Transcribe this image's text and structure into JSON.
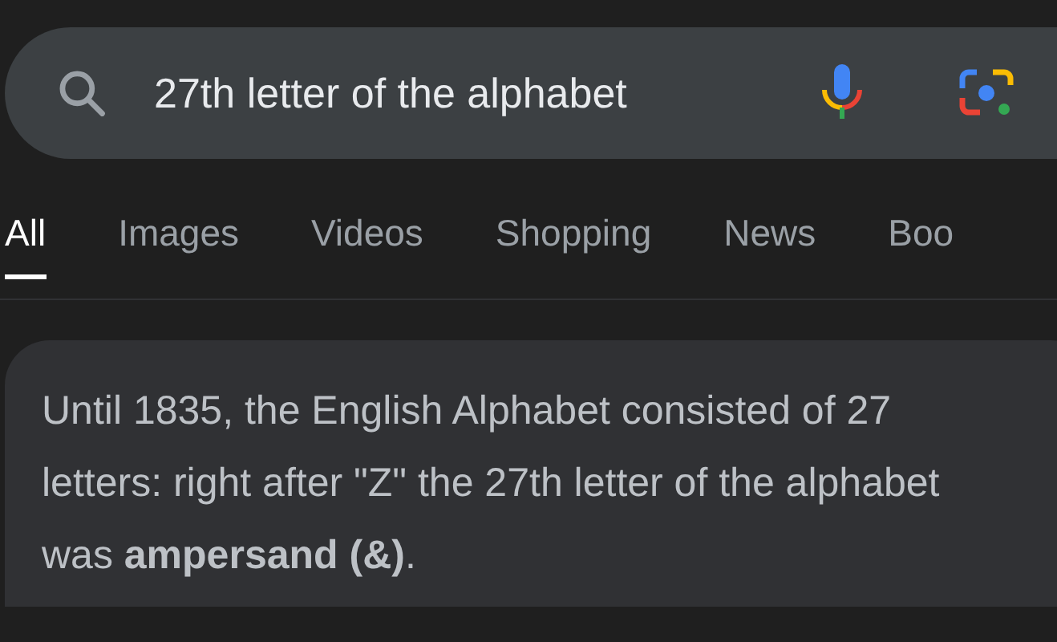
{
  "search": {
    "value": "27th letter of the alphabet"
  },
  "tabs": [
    {
      "label": "All",
      "selected": true
    },
    {
      "label": "Images",
      "selected": false
    },
    {
      "label": "Videos",
      "selected": false
    },
    {
      "label": "Shopping",
      "selected": false
    },
    {
      "label": "News",
      "selected": false
    },
    {
      "label": "Boo",
      "selected": false
    }
  ],
  "answer": {
    "text": "Until 1835, the English Alphabet consisted of 27 letters: right after \"Z\" the 27th letter of the alphabet was **ampersand (&)**."
  }
}
